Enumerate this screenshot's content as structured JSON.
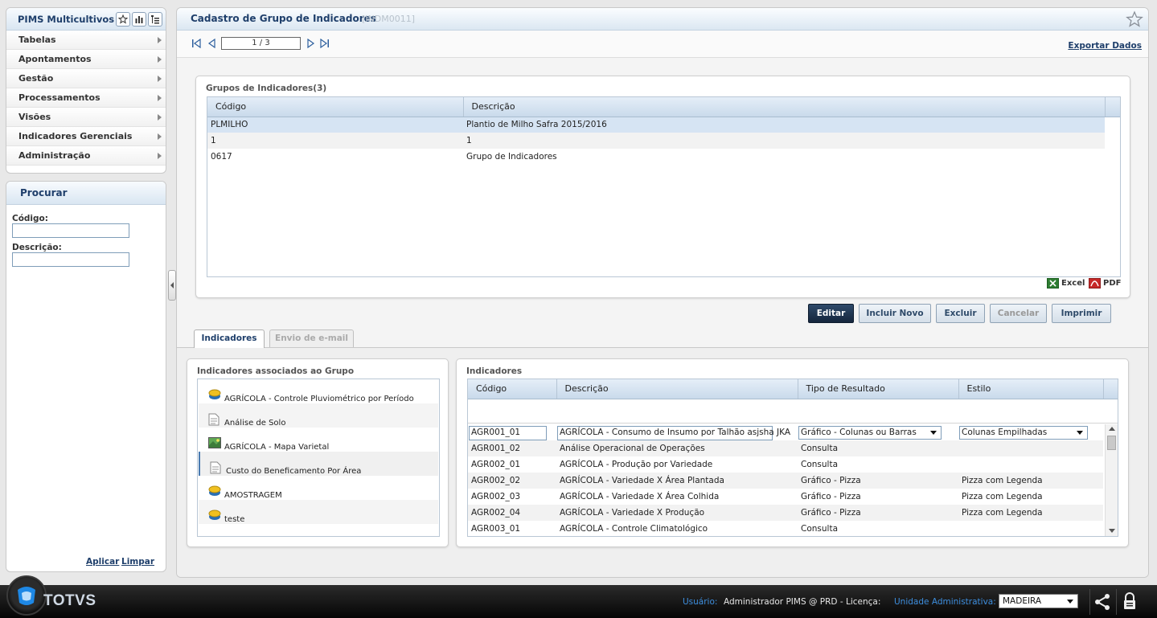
{
  "sidebar": {
    "app_title": "PIMS Multicultivos",
    "menu": [
      {
        "label": "Tabelas"
      },
      {
        "label": "Apontamentos"
      },
      {
        "label": "Gestão"
      },
      {
        "label": "Processamentos"
      },
      {
        "label": "Visões"
      },
      {
        "label": "Indicadores Gerenciais"
      },
      {
        "label": "Administração"
      }
    ],
    "search": {
      "title": "Procurar",
      "code_label": "Código:",
      "code_value": "",
      "desc_label": "Descrição:",
      "desc_value": "",
      "apply_label": "Aplicar",
      "clear_label": "Limpar"
    }
  },
  "main": {
    "title": "Cadastro de Grupo de Indicadores",
    "code": "[INDM0011]",
    "page_indicator": "1 / 3",
    "export_label": "Exportar Dados",
    "groups": {
      "title": "Grupos de Indicadores(3)",
      "columns": [
        "Código",
        "Descrição"
      ],
      "rows": [
        {
          "code": "PLMILHO",
          "desc": "Plantio de Milho Safra 2015/2016"
        },
        {
          "code": "1",
          "desc": "1"
        },
        {
          "code": "0617",
          "desc": "Grupo de Indicadores"
        }
      ],
      "excel_label": "Excel",
      "pdf_label": "PDF"
    },
    "buttons": {
      "edit": "Editar",
      "add": "Incluir Novo",
      "delete": "Excluir",
      "cancel": "Cancelar",
      "print": "Imprimir"
    },
    "tabs": [
      {
        "label": "Indicadores"
      },
      {
        "label": "Envio de e-mail"
      }
    ],
    "associated": {
      "title": "Indicadores associados ao Grupo",
      "items": [
        {
          "label": "AGRÍCOLA - Controle Pluviométrico por Período",
          "icon": "database-icon"
        },
        {
          "label": "Análise de Solo",
          "icon": "document-icon"
        },
        {
          "label": "AGRÍCOLA - Mapa Varietal",
          "icon": "map-image-icon"
        },
        {
          "label": "Custo do Beneficamento Por Área",
          "icon": "document-icon"
        },
        {
          "label": "AMOSTRAGEM",
          "icon": "database-icon"
        },
        {
          "label": "teste",
          "icon": "database-icon"
        }
      ]
    },
    "indicators": {
      "title": "Indicadores",
      "columns": [
        "Código",
        "Descrição",
        "Tipo de Resultado",
        "Estilo"
      ],
      "rows": [
        {
          "code": "AGR001_01",
          "desc": "AGRÍCOLA - Consumo de Insumo por Talhão asjsha JKA",
          "type": "Gráfico - Colunas ou Barras",
          "style": "Colunas Empilhadas"
        },
        {
          "code": "AGR001_02",
          "desc": "Análise Operacional de Operações",
          "type": "Consulta",
          "style": ""
        },
        {
          "code": "AGR002_01",
          "desc": "AGRÍCOLA - Produção por Variedade",
          "type": "Consulta",
          "style": ""
        },
        {
          "code": "AGR002_02",
          "desc": "AGRÍCOLA - Variedade X Área Plantada",
          "type": "Gráfico - Pizza",
          "style": "Pizza com Legenda"
        },
        {
          "code": "AGR002_03",
          "desc": "AGRÍCOLA - Variedade X Área Colhida",
          "type": "Gráfico - Pizza",
          "style": "Pizza com Legenda"
        },
        {
          "code": "AGR002_04",
          "desc": "AGRÍCOLA - Variedade X Produção",
          "type": "Gráfico - Pizza",
          "style": "Pizza com Legenda"
        },
        {
          "code": "AGR003_01",
          "desc": "AGRÍCOLA - Controle Climatológico",
          "type": "Consulta",
          "style": ""
        }
      ]
    }
  },
  "footer": {
    "brand": "TOTVS",
    "user_label": "Usuário:",
    "user_value": "Administrador PIMS @ PRD - Licença:",
    "unit_label": "Unidade Administrativa:",
    "unit_value": "MADEIRA"
  },
  "colors": {
    "accent": "#1f3f6b",
    "primary_button": "#1f3552",
    "footer_label": "#3d8ede"
  }
}
